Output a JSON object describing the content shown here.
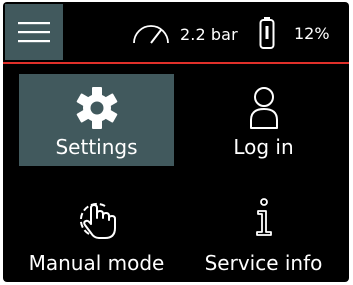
{
  "header": {
    "menu_icon": "hamburger-menu-icon",
    "pressure": {
      "icon": "gauge-icon",
      "value": "2.2 bar"
    },
    "battery": {
      "icon": "battery-icon",
      "value": "12%"
    },
    "divider_color": "#e0302a"
  },
  "tiles": [
    {
      "label": "Settings",
      "icon": "gear-icon",
      "active": true
    },
    {
      "label": "Log in",
      "icon": "user-icon",
      "active": false
    },
    {
      "label": "Manual mode",
      "icon": "gear-hand-icon",
      "active": false
    },
    {
      "label": "Service info",
      "icon": "info-icon",
      "active": false
    }
  ],
  "colors": {
    "background": "#000000",
    "accent_tile": "#41595d",
    "text": "#ffffff"
  }
}
